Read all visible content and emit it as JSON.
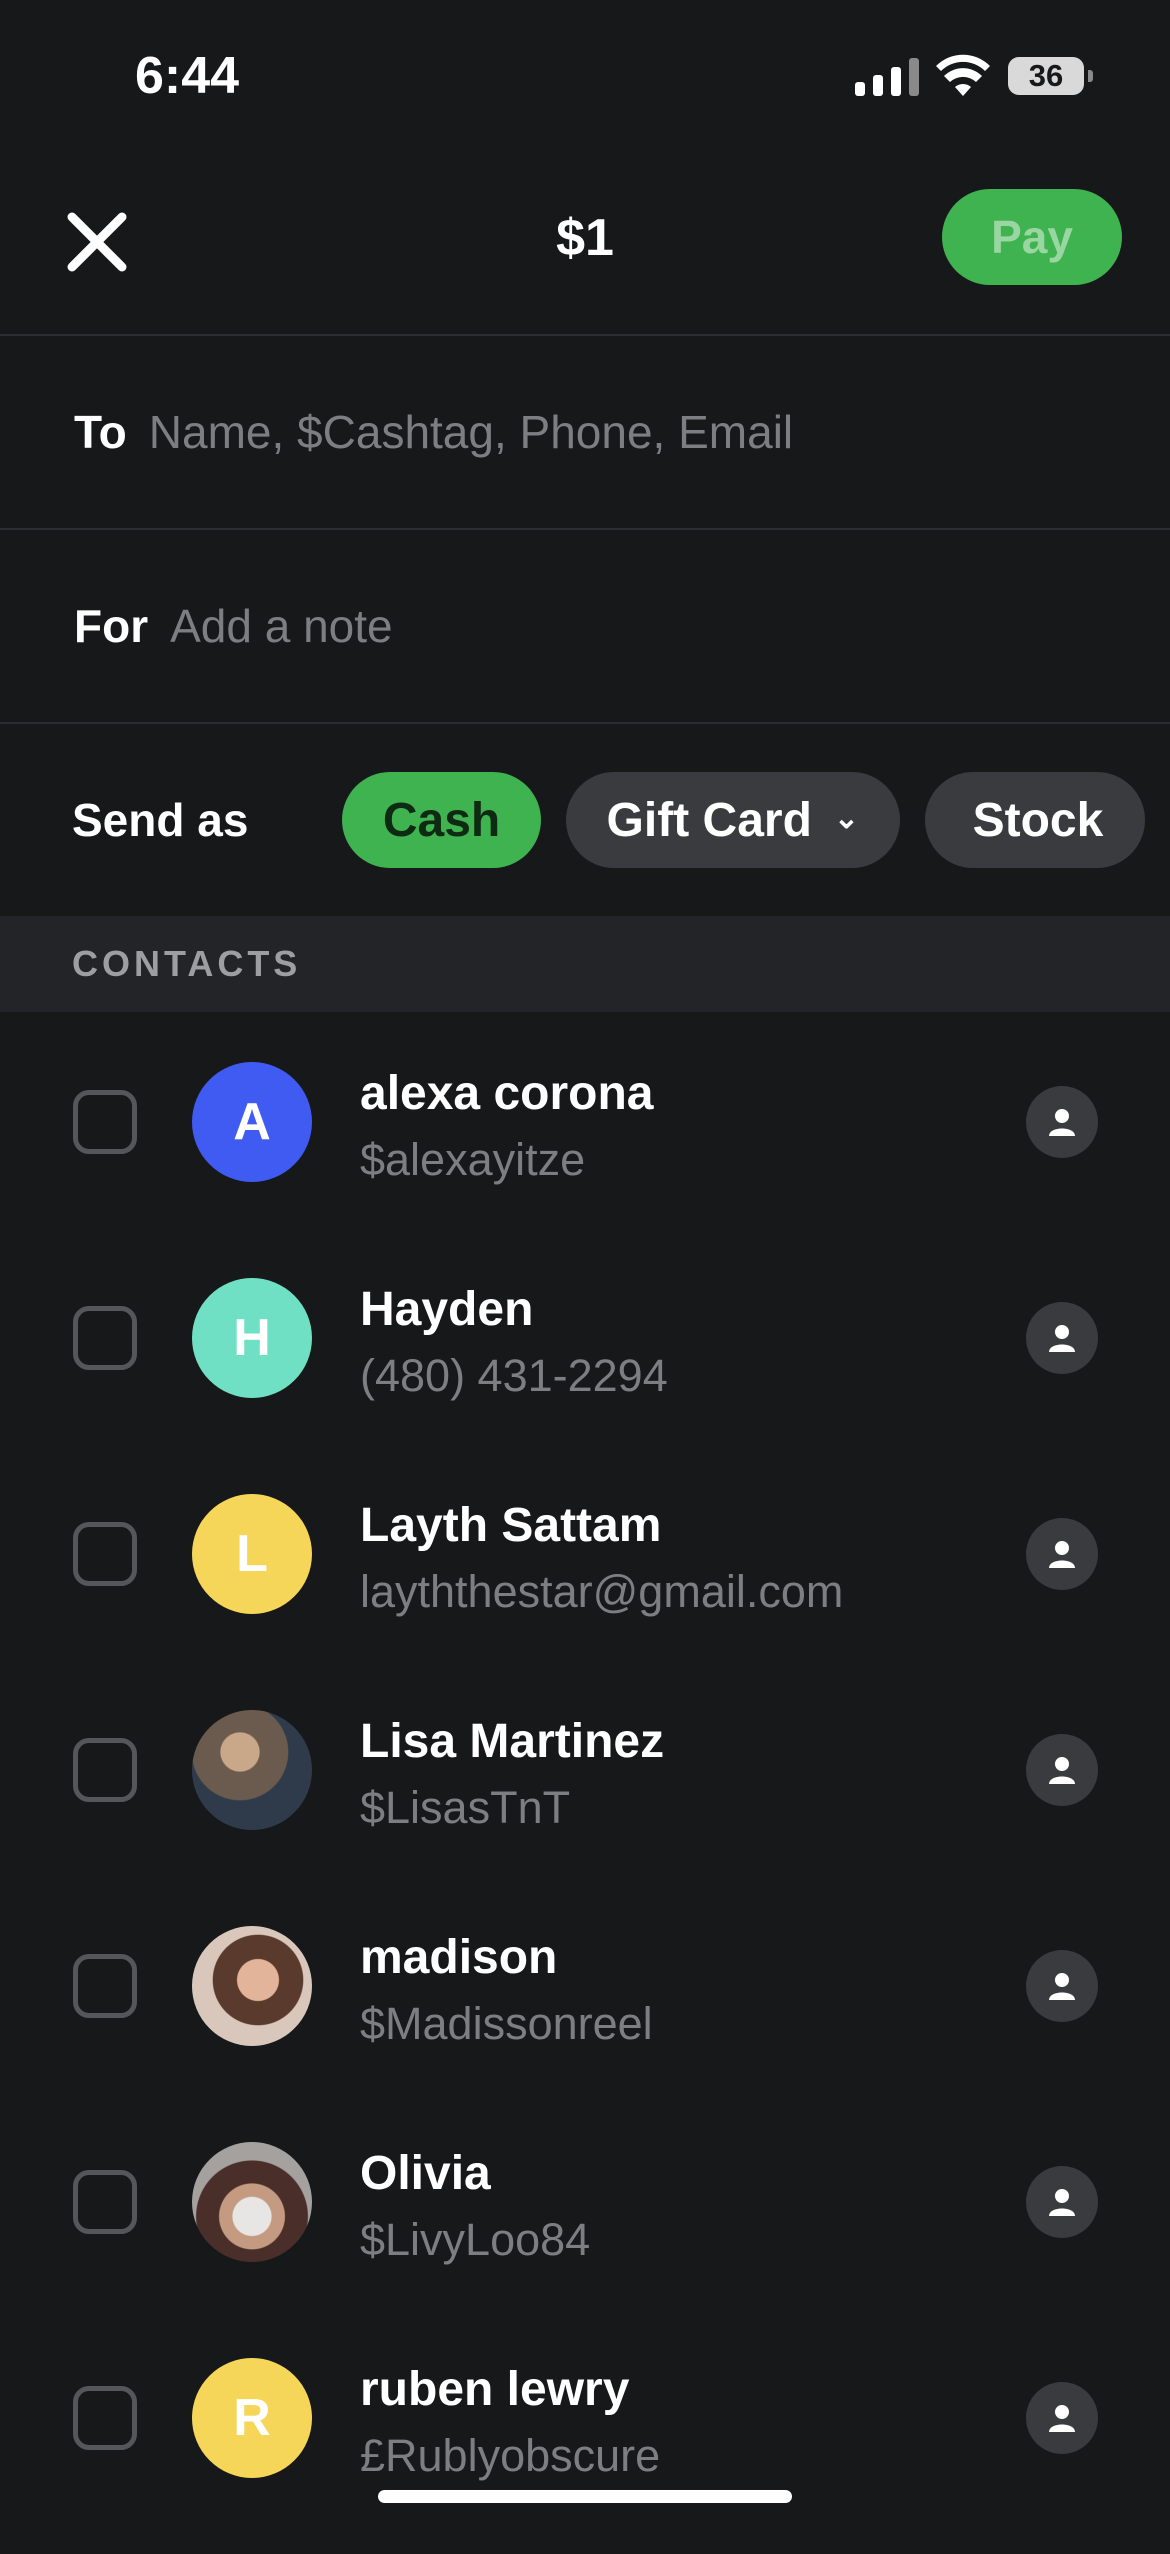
{
  "status_bar": {
    "time": "6:44",
    "battery": "36"
  },
  "header": {
    "close_icon": "close-icon",
    "amount": "$1",
    "pay_label": "Pay"
  },
  "to_row": {
    "label": "To",
    "placeholder": "Name, $Cashtag, Phone, Email"
  },
  "for_row": {
    "label": "For",
    "placeholder": "Add a note"
  },
  "send_as": {
    "label": "Send as",
    "options": [
      {
        "label": "Cash"
      },
      {
        "label": "Gift Card"
      },
      {
        "label": "Stock"
      }
    ]
  },
  "contacts_header": "CONTACTS",
  "contacts": [
    {
      "initial": "A",
      "name": "alexa corona",
      "sub": "$alexayitze",
      "color": "#3f5bf2"
    },
    {
      "initial": "H",
      "name": "Hayden",
      "sub": "(480) 431-2294",
      "color": "#6fe0c3"
    },
    {
      "initial": "L",
      "name": "Layth Sattam",
      "sub": "layththestar@gmail.com",
      "color": "#f5d658"
    },
    {
      "initial": "",
      "name": "Lisa Martinez",
      "sub": "$LisasTnT",
      "color": "#6b5a4e"
    },
    {
      "initial": "",
      "name": "madison",
      "sub": "$Madissonreel",
      "color": "#8a6650"
    },
    {
      "initial": "",
      "name": "Olivia",
      "sub": "$LivyLoo84",
      "color": "#5c4a40"
    },
    {
      "initial": "R",
      "name": "ruben lewry",
      "sub": "£Rublyobscure",
      "color": "#f5d658"
    }
  ],
  "colors": {
    "accent_green": "#3fb34f",
    "background": "#17181a"
  }
}
